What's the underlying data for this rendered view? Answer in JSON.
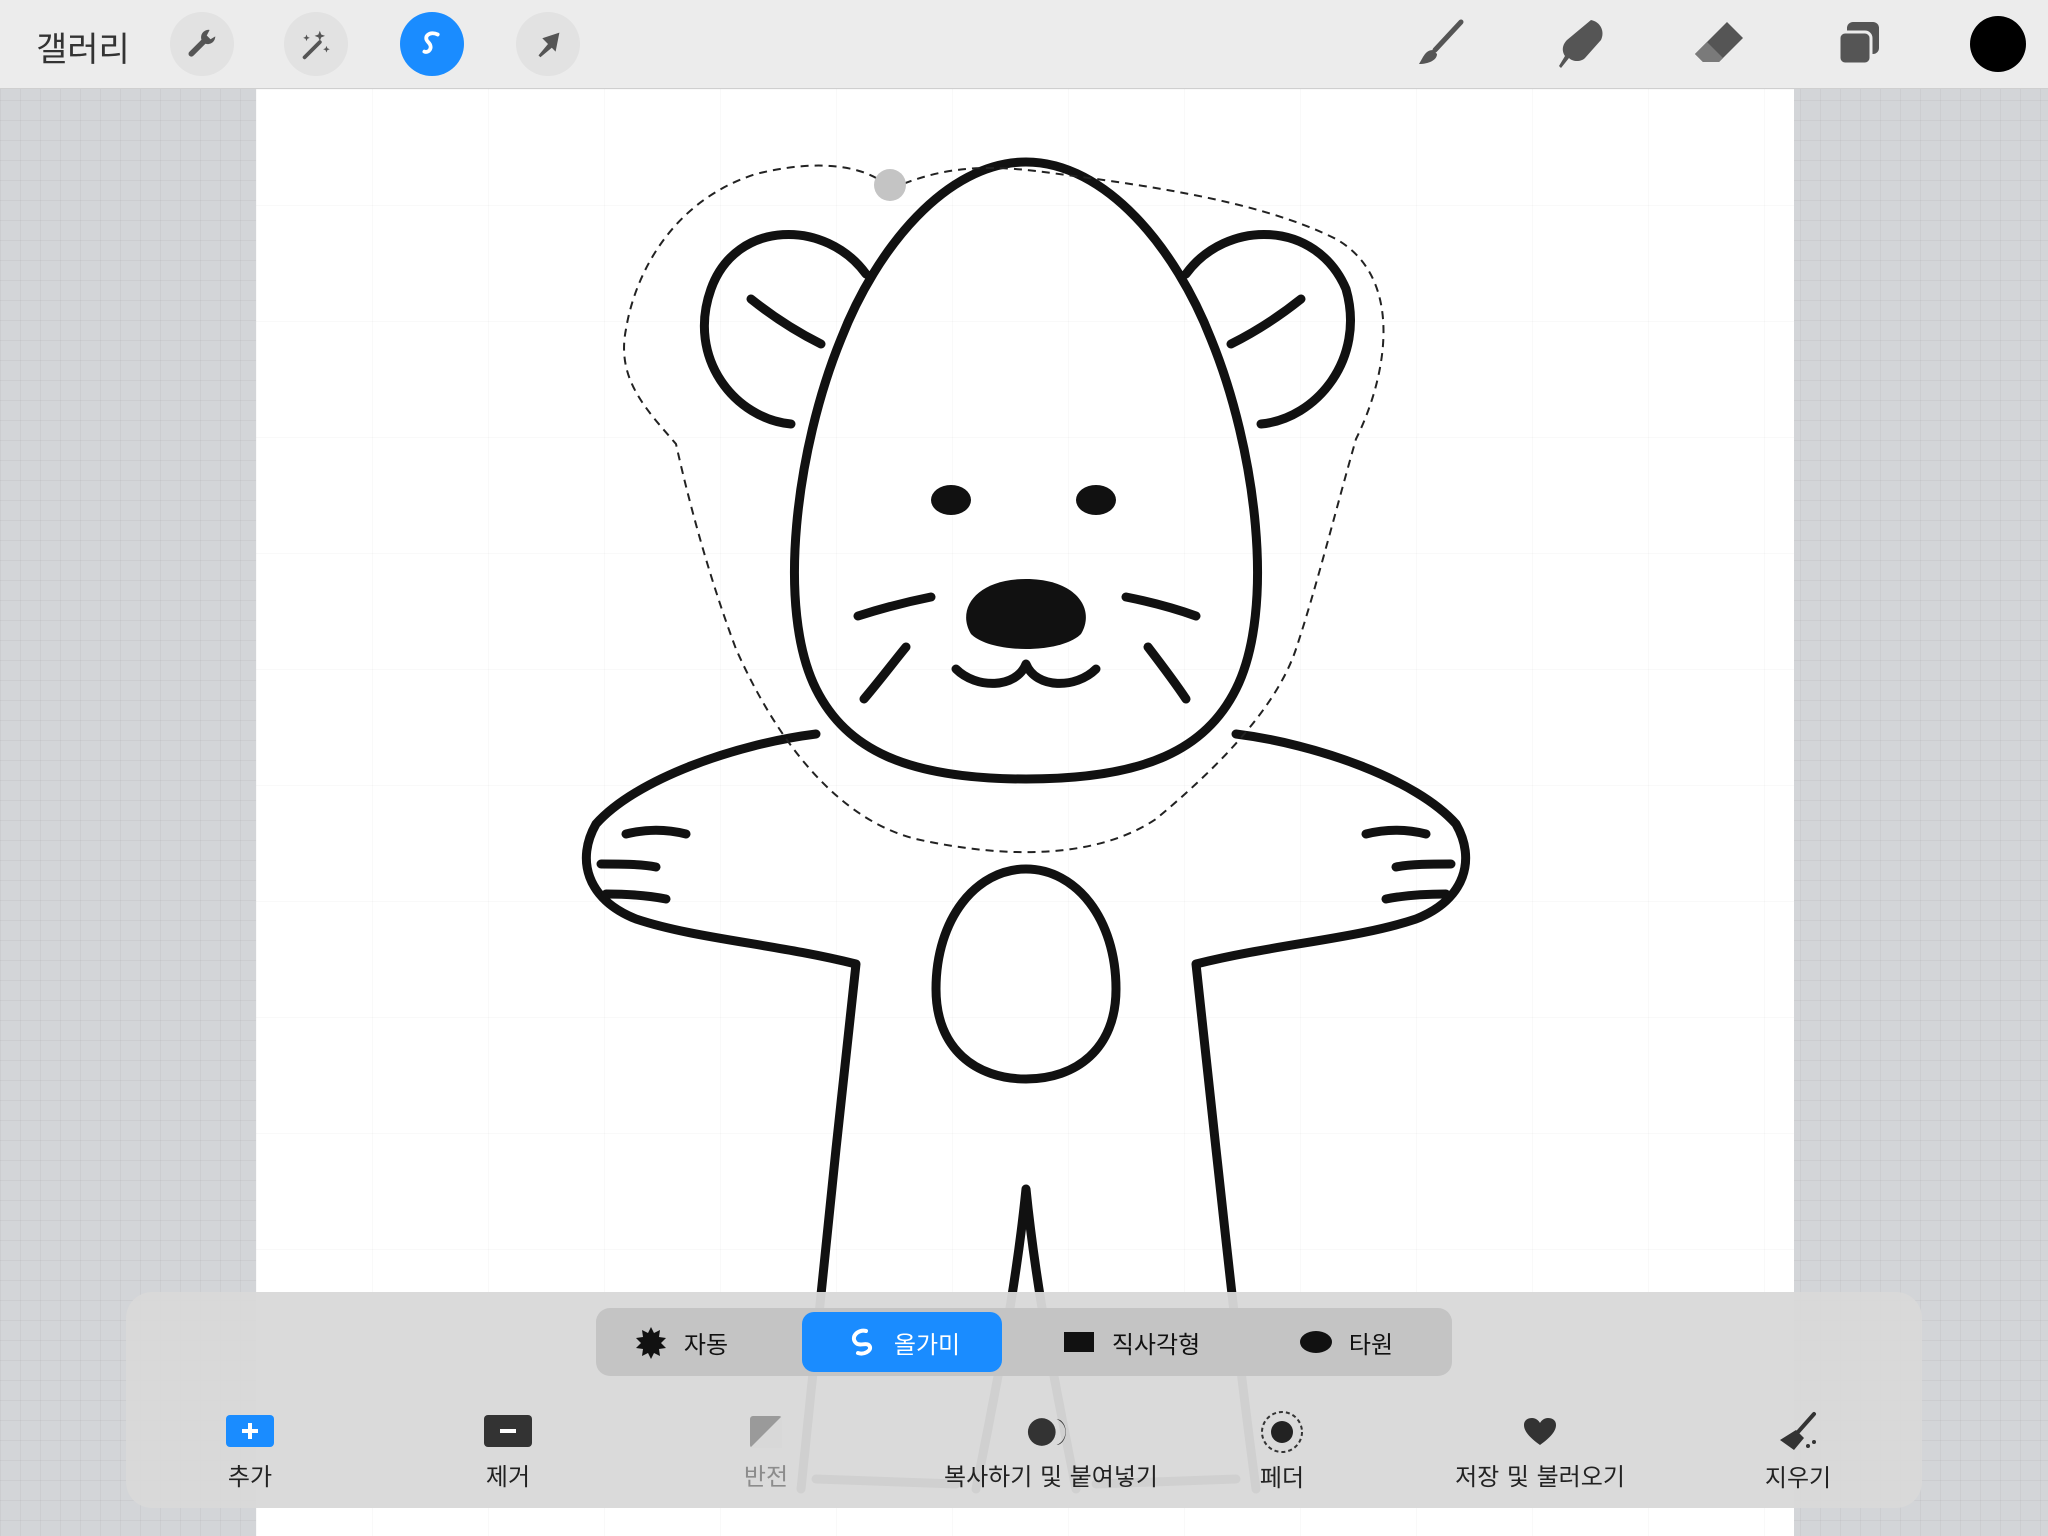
{
  "topbar": {
    "gallery_label": "갤러리",
    "left_tools": [
      {
        "icon": "wrench-icon",
        "label": "Actions"
      },
      {
        "icon": "magic-wand-icon",
        "label": "Adjustments"
      },
      {
        "icon": "selection-icon",
        "label": "Selection",
        "active": true
      },
      {
        "icon": "arrow-cursor-icon",
        "label": "Transform"
      }
    ],
    "right_tools": [
      {
        "icon": "brush-icon",
        "label": "Paint"
      },
      {
        "icon": "smudge-icon",
        "label": "Smudge"
      },
      {
        "icon": "eraser-icon",
        "label": "Erase"
      },
      {
        "icon": "layers-icon",
        "label": "Layers"
      }
    ],
    "color": "#000000"
  },
  "selection_modes": {
    "auto": "자동",
    "freehand": "올가미",
    "rectangle": "직사각형",
    "ellipse": "타원",
    "active": "freehand"
  },
  "actions": {
    "add": "추가",
    "remove": "제거",
    "invert": "반전",
    "copy_paste": "복사하기 및 붙여넣기",
    "feather": "페더",
    "save_load": "저장 및 불러오기",
    "clear": "지우기"
  },
  "colors": {
    "accent": "#1a8cff",
    "panel": "#d8d8d8",
    "canvas": "#ffffff"
  }
}
